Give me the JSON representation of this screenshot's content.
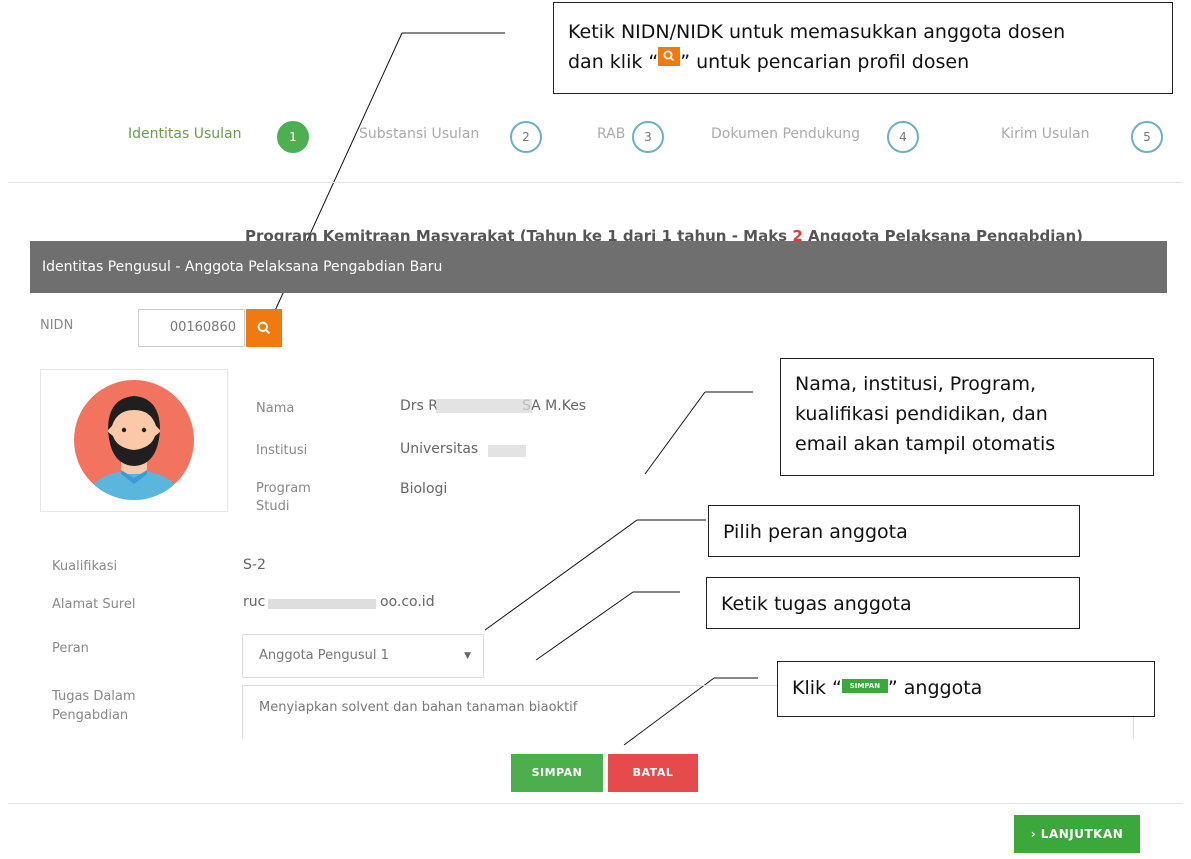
{
  "annotations": {
    "search": {
      "line1": "Ketik NIDN/NIDK untuk memasukkan anggota dosen",
      "line2_pre": "dan klik “",
      "line2_post": "” untuk pencarian profil dosen"
    },
    "auto": {
      "line1": "Nama, institusi, Program,",
      "line2": "kualifikasi pendidikan, dan",
      "line3": "email akan tampil otomatis"
    },
    "role": "Pilih peran anggota",
    "task": "Ketik tugas anggota",
    "save": {
      "pre": "Klik “",
      "mini_label": "SIMPAN",
      "post": "” anggota"
    }
  },
  "stepper": [
    {
      "label": "Identitas Usulan",
      "number": "1",
      "active": true
    },
    {
      "label": "Substansi Usulan",
      "number": "2",
      "active": false
    },
    {
      "label": "RAB",
      "number": "3",
      "active": false
    },
    {
      "label": "Dokumen Pendukung",
      "number": "4",
      "active": false
    },
    {
      "label": "Kirim Usulan",
      "number": "5",
      "active": false
    }
  ],
  "program": {
    "prefix": "Program Kemitraan Masyarakat (Tahun ke 1 dari 1 tahun - Maks ",
    "max": "2",
    "suffix": " Anggota Pelaksana Pengabdian)"
  },
  "panel_title": "Identitas Pengusul - Anggota Pelaksana Pengabdian Baru",
  "form": {
    "nidn_label": "NIDN",
    "nidn_value": "00160860",
    "nama_label": "Nama",
    "nama_value": "Drs R      SA M.Kes",
    "institusi_label": "Institusi",
    "institusi_value": "Universitas",
    "prodi_label_1": "Program",
    "prodi_label_2": "Studi",
    "prodi_value": "Biologi",
    "kualifikasi_label": "Kualifikasi",
    "kualifikasi_value": "S-2",
    "surel_label": "Alamat Surel",
    "surel_value_start": "ruc",
    "surel_value_end": "oo.co.id",
    "peran_label": "Peran",
    "peran_value": "Anggota Pengusul 1",
    "tugas_label_1": "Tugas Dalam",
    "tugas_label_2": "Pengabdian",
    "tugas_value": "Menyiapkan solvent dan bahan tanaman biaoktif"
  },
  "buttons": {
    "simpan": "SIMPAN",
    "batal": "BATAL",
    "lanjutkan": "› LANJUTKAN"
  },
  "colors": {
    "orange": "#f07a0f",
    "green": "#4cae4c",
    "red": "#e54b4b",
    "header_gray": "#6f6f6f",
    "step_ring": "#6ab0c8"
  }
}
